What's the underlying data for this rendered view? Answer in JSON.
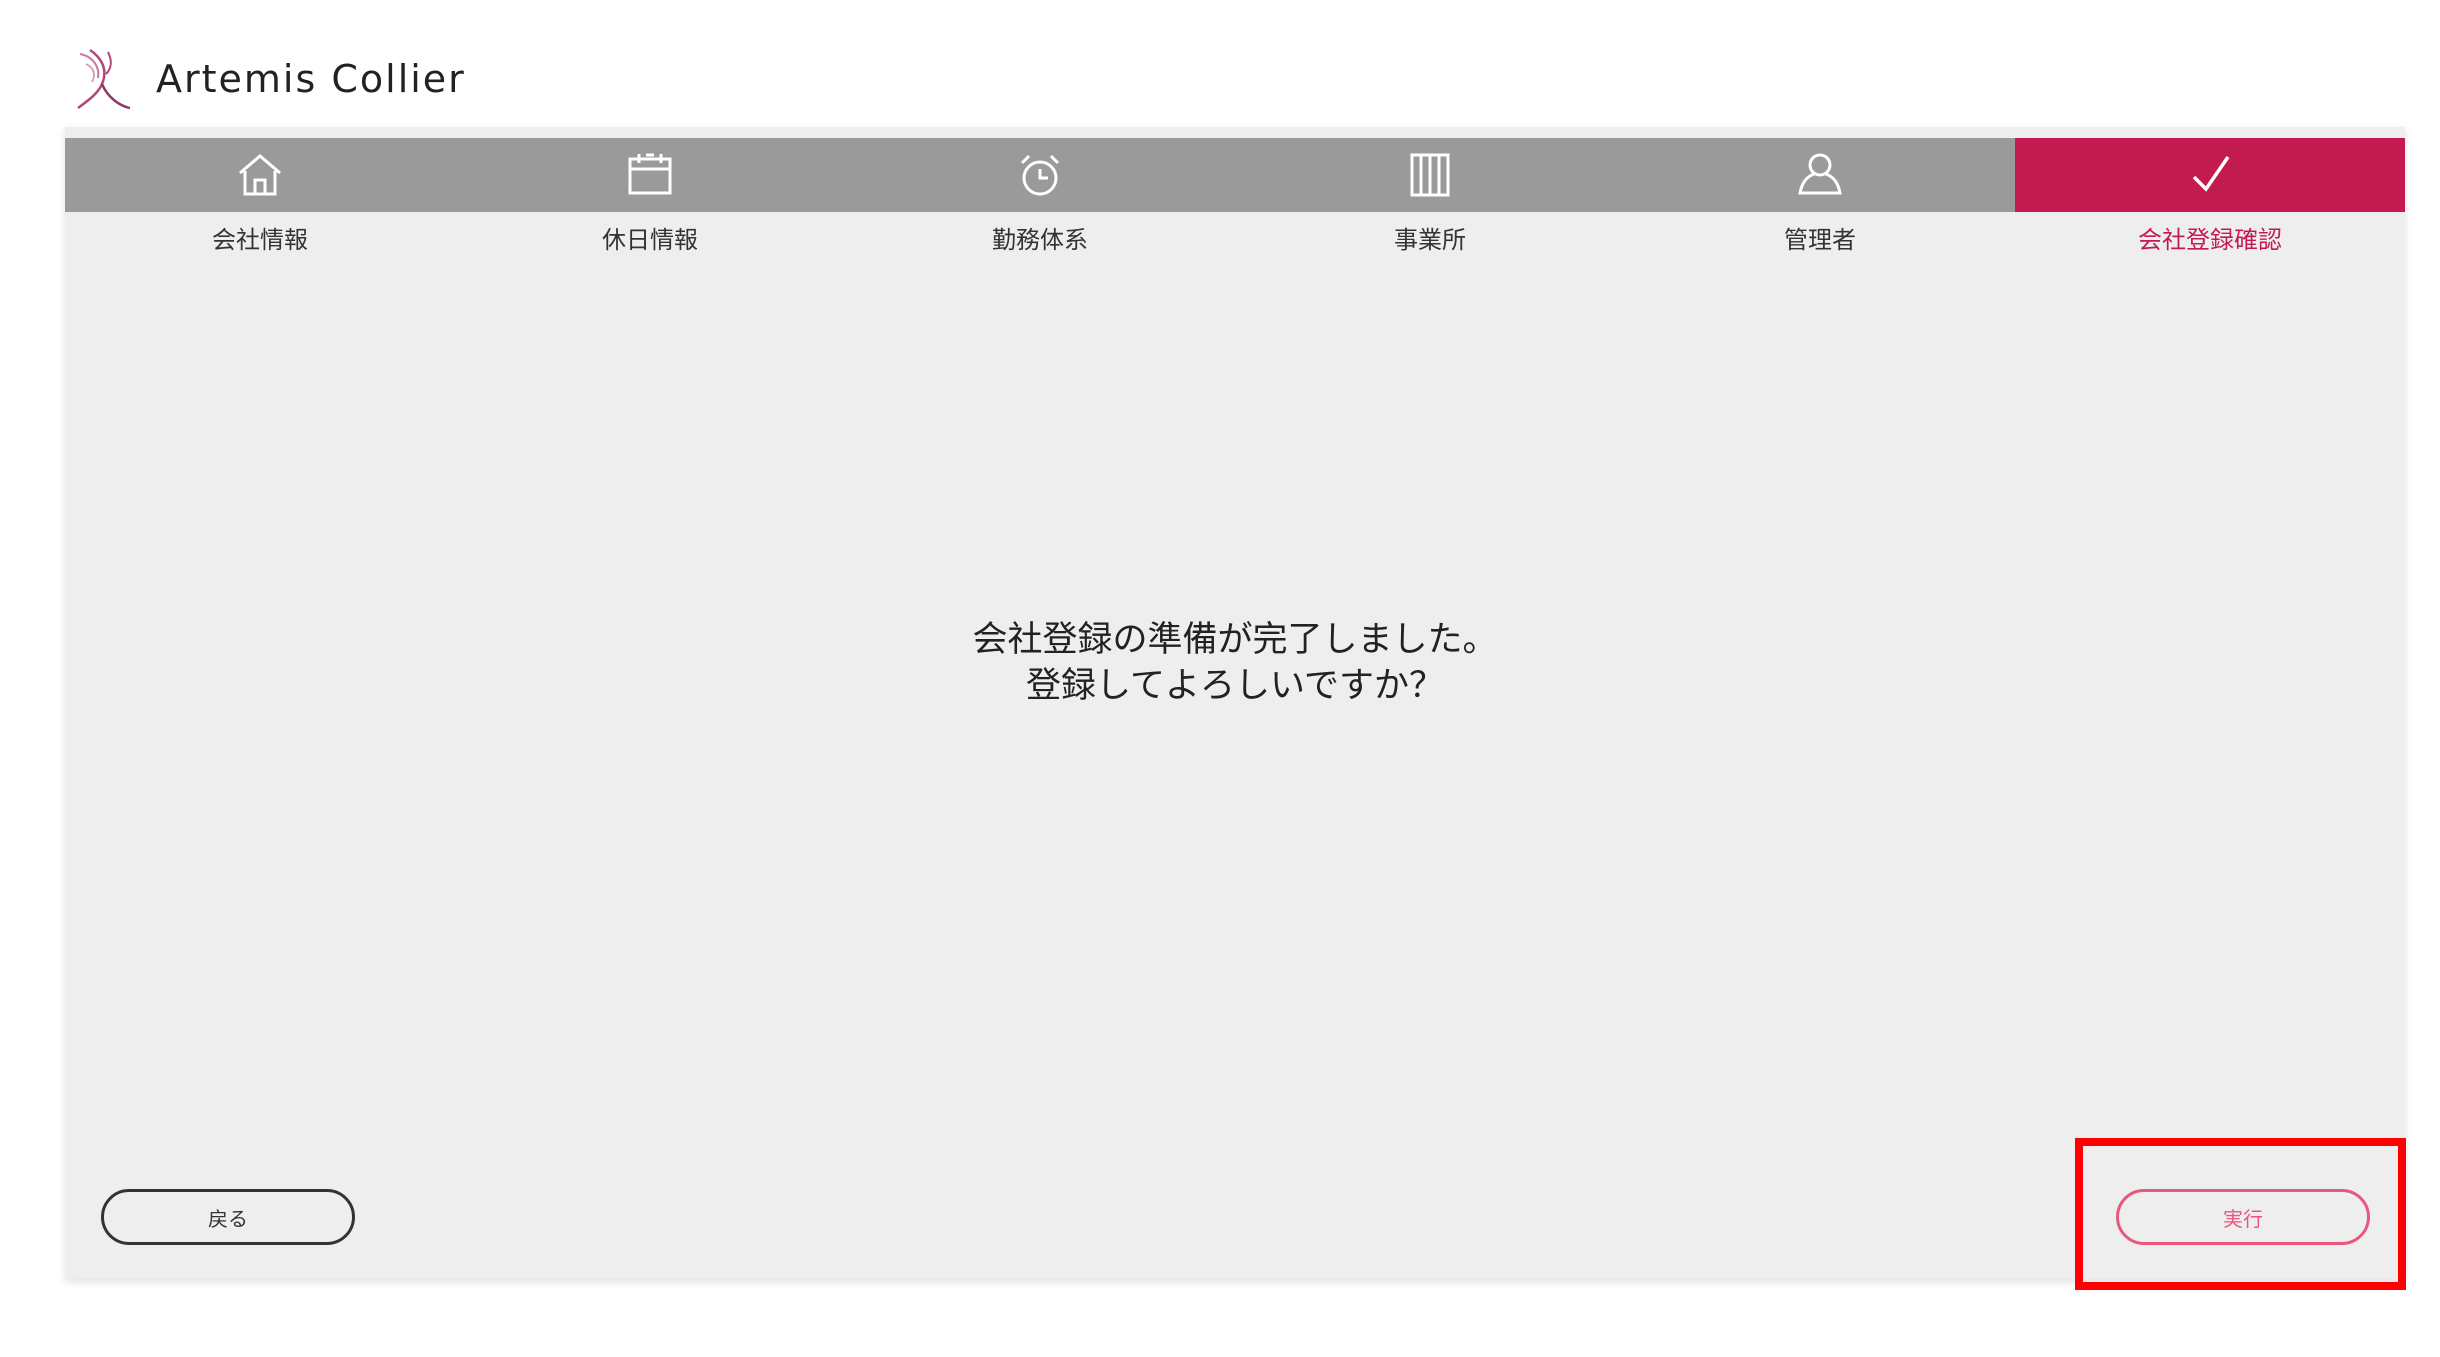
{
  "app": {
    "brand_name": "Artemis Collier"
  },
  "steps": [
    {
      "label": "会社情報",
      "icon": "home-icon",
      "active": false
    },
    {
      "label": "休日情報",
      "icon": "calendar-icon",
      "active": false
    },
    {
      "label": "勤務体系",
      "icon": "alarm-clock-icon",
      "active": false
    },
    {
      "label": "事業所",
      "icon": "office-columns-icon",
      "active": false
    },
    {
      "label": "管理者",
      "icon": "user-icon",
      "active": false
    },
    {
      "label": "会社登録確認",
      "icon": "check-icon",
      "active": true
    }
  ],
  "message": {
    "line1": "会社登録の準備が完了しました。",
    "line2": "登録してよろしいですか？"
  },
  "buttons": {
    "back_label": "戻る",
    "execute_label": "実行"
  },
  "colors": {
    "accent": "#c31b4f",
    "step_inactive": "#9a9a9a",
    "panel": "#eeeeee",
    "highlight": "#ff0000",
    "execute_border": "#e8577e"
  }
}
